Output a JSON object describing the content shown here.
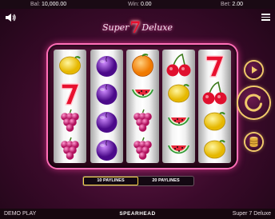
{
  "topbar": {
    "bal_label": "Bal:",
    "bal_value": "10,000.00",
    "win_label": "Win:",
    "win_value": "0.00",
    "bet_label": "Bet:",
    "bet_value": "2.00"
  },
  "logo": {
    "word1": "Super",
    "seven": "7",
    "word2": "Deluxe"
  },
  "reels": [
    [
      "lemon",
      "seven",
      "grapes",
      "grapes"
    ],
    [
      "plum",
      "plum",
      "plum",
      "plum"
    ],
    [
      "orange",
      "watermelon",
      "grapes",
      "grapes"
    ],
    [
      "cherry",
      "lemon",
      "watermelon",
      "watermelon"
    ],
    [
      "seven",
      "cherry",
      "lemon",
      "lemon"
    ]
  ],
  "controls": {
    "autoplay_icon": "play-icon",
    "spin_icon": "spin-arrow-icon",
    "bet_icon": "coin-stack-icon"
  },
  "paylines": {
    "option_1": "10 PAYLINES",
    "option_2": "20 PAYLINES",
    "selected": "10 PAYLINES"
  },
  "bottombar": {
    "mode": "DEMO PLAY",
    "brand": "SPEARHEAD",
    "game_name": "Super 7 Deluxe"
  },
  "colors": {
    "accent_pink": "#ff3c9e",
    "gold": "#f1c96a",
    "seven_red": "#e8102e"
  }
}
